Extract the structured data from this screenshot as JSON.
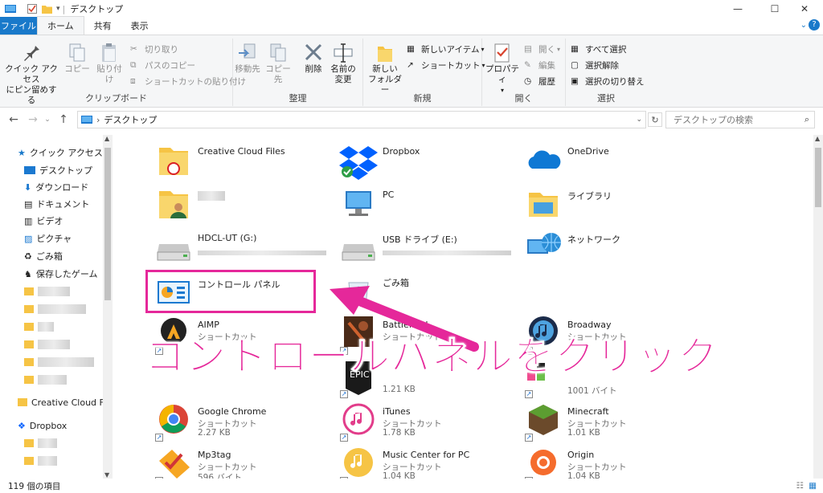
{
  "window": {
    "title": "デスクトップ",
    "min": "—",
    "max": "☐",
    "close": "✕"
  },
  "tabs": {
    "file": "ファイル",
    "home": "ホーム",
    "share": "共有",
    "view": "表示"
  },
  "ribbon": {
    "clipboard": {
      "label": "クリップボード",
      "pin": "クイック アクセスにピン留めする",
      "pin_l1": "クイック アクセス",
      "pin_l2": "にピン留めする",
      "copy": "コピー",
      "paste": "貼り付け",
      "cut": "切り取り",
      "copy_path": "パスのコピー",
      "paste_shortcut": "ショートカットの貼り付け"
    },
    "organize": {
      "label": "整理",
      "move": "移動先",
      "copyto": "コピー先",
      "delete": "削除",
      "rename_l1": "名前の",
      "rename_l2": "変更"
    },
    "new": {
      "label": "新規",
      "folder_l1": "新しい",
      "folder_l2": "フォルダー",
      "new_item": "新しいアイテム",
      "shortcut": "ショートカット"
    },
    "open": {
      "label": "開く",
      "properties": "プロパティ",
      "open": "開く",
      "edit": "編集",
      "history": "履歴"
    },
    "select": {
      "label": "選択",
      "all": "すべて選択",
      "none": "選択解除",
      "invert": "選択の切り替え"
    }
  },
  "address": {
    "path": "デスクトップ",
    "search_placeholder": "デスクトップの検索"
  },
  "sidebar": {
    "quick_access": "クイック アクセス",
    "items": [
      "デスクトップ",
      "ダウンロード",
      "ドキュメント",
      "ビデオ",
      "ピクチャ",
      "ごみ箱",
      "保存したゲーム"
    ],
    "creative_cloud": "Creative Cloud Files",
    "dropbox": "Dropbox"
  },
  "files": [
    {
      "name": "Creative Cloud Files",
      "sub": "",
      "size": ""
    },
    {
      "name": "Dropbox",
      "sub": "",
      "size": ""
    },
    {
      "name": "OneDrive",
      "sub": "",
      "size": ""
    },
    {
      "name": "",
      "sub": "",
      "size": ""
    },
    {
      "name": "PC",
      "sub": "",
      "size": ""
    },
    {
      "name": "ライブラリ",
      "sub": "",
      "size": ""
    },
    {
      "name": "HDCL-UT (G:)",
      "sub": "",
      "size": ""
    },
    {
      "name": "USB ドライブ (E:)",
      "sub": "",
      "size": ""
    },
    {
      "name": "ネットワーク",
      "sub": "",
      "size": ""
    },
    {
      "name": "コントロール パネル",
      "sub": "",
      "size": ""
    },
    {
      "name": "ごみ箱",
      "sub": "",
      "size": ""
    },
    {
      "name": "",
      "sub": "",
      "size": ""
    },
    {
      "name": "AIMP",
      "sub": "ショートカット",
      "size": ""
    },
    {
      "name": "Battlefield",
      "sub": "ショートカット",
      "size": ""
    },
    {
      "name": "Broadway",
      "sub": "ショートカット",
      "size": ""
    },
    {
      "name": "",
      "sub": "",
      "size": ""
    },
    {
      "name": "",
      "sub": "",
      "size": "1.21 KB"
    },
    {
      "name": "",
      "sub": "",
      "size": "1001 バイト"
    },
    {
      "name": "Google Chrome",
      "sub": "ショートカット",
      "size": "2.27 KB"
    },
    {
      "name": "iTunes",
      "sub": "ショートカット",
      "size": "1.78 KB"
    },
    {
      "name": "Minecraft",
      "sub": "ショートカット",
      "size": "1.01 KB"
    },
    {
      "name": "Mp3tag",
      "sub": "ショートカット",
      "size": "596 バイト"
    },
    {
      "name": "Music Center for PC",
      "sub": "ショートカット",
      "size": "1.04 KB"
    },
    {
      "name": "Origin",
      "sub": "ショートカット",
      "size": "1.04 KB"
    }
  ],
  "status": {
    "count": "119 個の項目"
  },
  "annotation": {
    "text": "コントロールパネルをクリック",
    "color": "#e5289a"
  },
  "colors": {
    "accent": "#1979ca",
    "highlight": "#e5289a"
  }
}
